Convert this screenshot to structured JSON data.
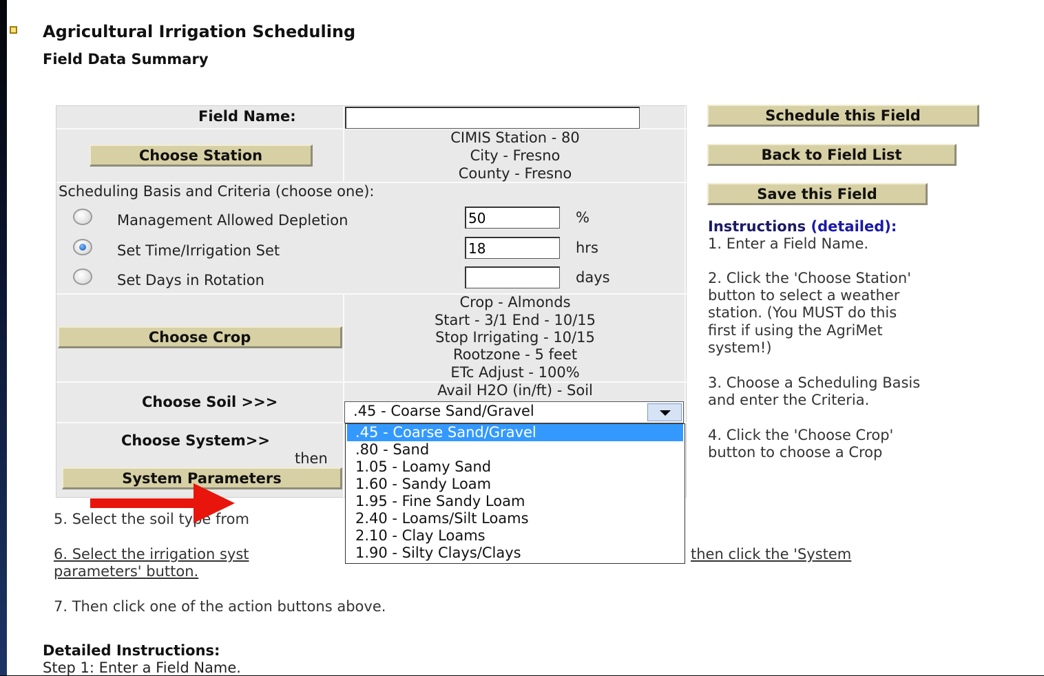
{
  "header": {
    "title": "Agricultural Irrigation Scheduling",
    "subtitle": "Field Data Summary"
  },
  "form": {
    "field_name_label": "Field Name:",
    "field_name_value": "",
    "choose_station_label": "Choose Station",
    "station": {
      "line1": "CIMIS Station - 80",
      "line2": "City - Fresno",
      "line3": "County - Fresno"
    },
    "criteria_heading": "Scheduling Basis and Criteria (choose one):",
    "criteria": [
      {
        "label": "Management Allowed Depletion",
        "value": "50",
        "unit": "%",
        "selected": false
      },
      {
        "label": "Set Time/Irrigation Set",
        "value": "18",
        "unit": "hrs",
        "selected": true
      },
      {
        "label": "Set Days in Rotation",
        "value": "",
        "unit": "days",
        "selected": false
      }
    ],
    "choose_crop_label": "Choose Crop",
    "crop": {
      "line1": "Crop - Almonds",
      "line2": "Start - 3/1 End - 10/15",
      "line3": "Stop Irrigating - 10/15",
      "line4": "Rootzone - 5 feet",
      "line5": "ETc Adjust - 100%"
    },
    "choose_soil_label": "Choose Soil >>>",
    "soil_header": "Avail H2O (in/ft) - Soil",
    "soil_selected": ".45 - Coarse Sand/Gravel",
    "soil_options": [
      ".45 - Coarse Sand/Gravel",
      ".80 - Sand",
      "1.05 - Loamy Sand",
      "1.60 - Sandy Loam",
      "1.95 - Fine Sandy Loam",
      "2.40 - Loams/Silt Loams",
      "2.10 - Clay Loams",
      "1.90 - Silty Clays/Clays"
    ],
    "choose_system_label": "Choose System>>",
    "then_label": "then",
    "system_parameters_label": "System Parameters"
  },
  "actions": {
    "schedule_label": "Schedule this Field",
    "back_label": "Back to Field List",
    "save_label": "Save this Field"
  },
  "instructions": {
    "heading": "Instructions",
    "detailed_link": "(detailed):",
    "step1": "1. Enter a Field Name.",
    "step2a": "2. Click the 'Choose Station'",
    "step2b": "button to select a weather",
    "step2c": "station. (You MUST do this",
    "step2d": "first if using the AgriMet",
    "step2e": "system!)",
    "step3a": "3. Choose a Scheduling Basis",
    "step3b": "and enter the Criteria.",
    "step4a": "4. Click the 'Choose Crop'",
    "step4b": "button to choose a Crop",
    "step5": "5. Select the soil type from",
    "step6a": "6. Select the irrigation syst",
    "step6b": "then click the 'System",
    "step6c": "parameters' button.",
    "step7": "7. Then click one of the action buttons above."
  },
  "detailed": {
    "heading": "Detailed Instructions:",
    "step1": "Step 1: Enter a Field Name."
  },
  "colors": {
    "button_bg": "#d7d0a4",
    "panel_bg": "#e9e9e9",
    "highlight": "#3399ff",
    "link": "#1a1aa6",
    "arrow": "#e8150c"
  }
}
